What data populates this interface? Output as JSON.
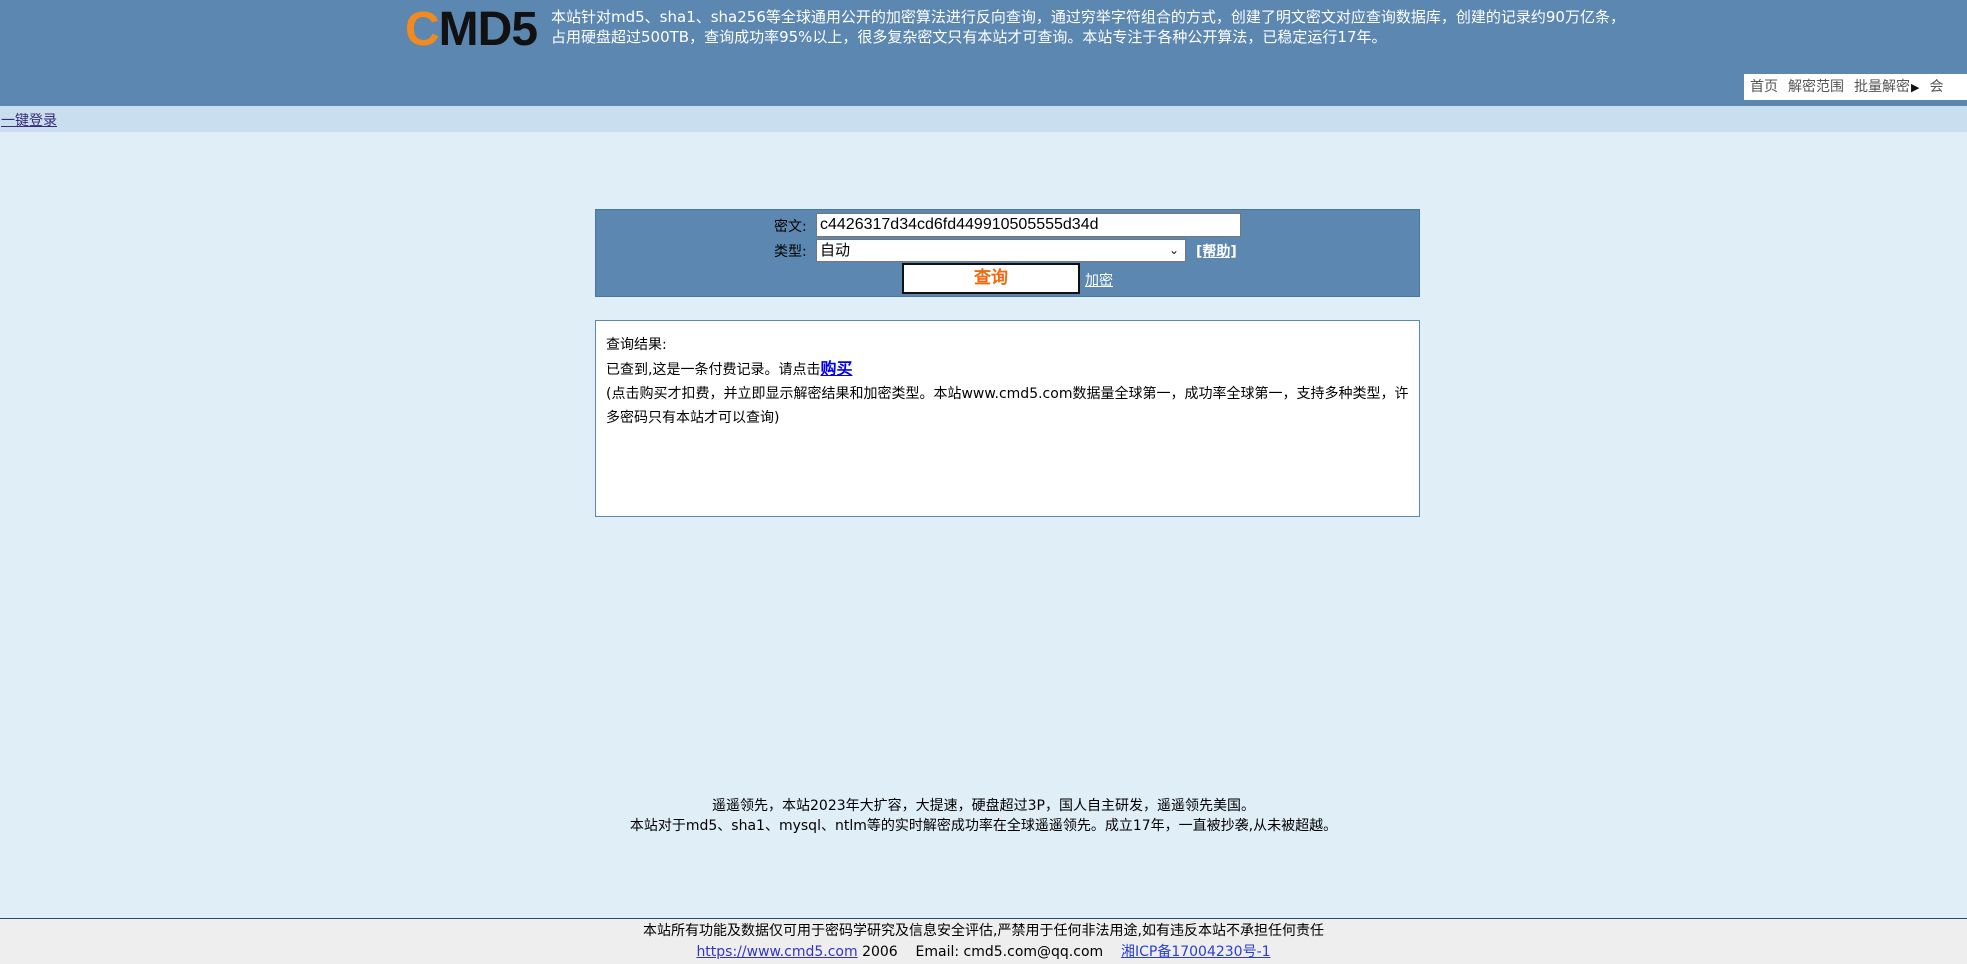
{
  "header": {
    "logo": {
      "first_letter": "C",
      "rest": "MD5"
    },
    "intro": "本站针对md5、sha1、sha256等全球通用公开的加密算法进行反向查询，通过穷举字符组合的方式，创建了明文密文对应查询数据库，创建的记录约90万亿条，占用硬盘超过500TB，查询成功率95%以上，很多复杂密文只有本站才可查询。本站专注于各种公开算法，已稳定运行17年。",
    "nav": {
      "items": [
        "首页",
        "解密范围",
        "批量解密",
        "会"
      ],
      "arrow_icon": "caret-right-icon"
    }
  },
  "login": {
    "link_text": "一键登录"
  },
  "search": {
    "ciphertext_label": "密文:",
    "ciphertext_value": "c4426317d34cd6fd449910505555d34d",
    "type_label": "类型:",
    "type_selected": "自动",
    "help_link": "[帮助]",
    "query_button": "查询",
    "encrypt_link": "加密"
  },
  "result": {
    "heading": "查询结果:",
    "found_text": "已查到,这是一条付费记录。请点击",
    "buy_link": "购买",
    "note": "(点击购买才扣费，并立即显示解密结果和加密类型。本站www.cmd5.com数据量全球第一，成功率全球第一，支持多种类型，许多密码只有本站才可以查询)"
  },
  "promo": {
    "line1": "遥遥领先，本站2023年大扩容，大提速，硬盘超过3P，国人自主研发，遥遥领先美国。",
    "line2": "本站对于md5、sha1、mysql、ntlm等的实时解密成功率在全球遥遥领先。成立17年，一直被抄袭,从未被超越。"
  },
  "footer": {
    "disclaimer": "本站所有功能及数据仅可用于密码学研究及信息安全评估,严禁用于任何非法用途,如有违反本站不承担任何责任",
    "site_link": "https://www.cmd5.com",
    "year": "2006",
    "email": "Email: cmd5.com@qq.com",
    "icp": "湘ICP备17004230号-1"
  },
  "colors": {
    "header_bg": "#5b87b1",
    "page_bg": "#e0eef7",
    "login_bar_bg": "#c9deef",
    "logo_accent": "#f28a1e",
    "query_button_text": "#f06a10",
    "footer_bg": "#eeeeee"
  }
}
